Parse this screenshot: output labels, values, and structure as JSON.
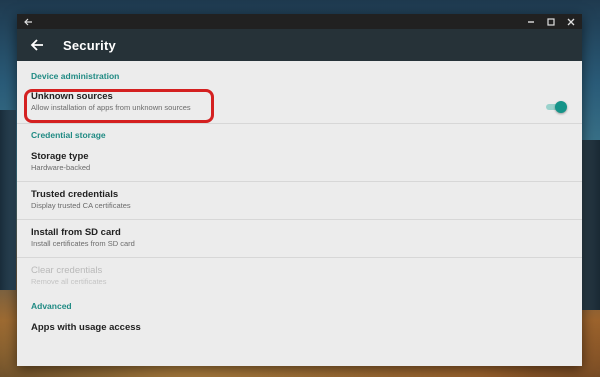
{
  "window": {
    "title_icons": [
      "back-arrow-icon",
      "minimize-icon",
      "maximize-icon",
      "close-icon"
    ]
  },
  "appbar": {
    "title": "Security"
  },
  "sections": {
    "device_admin": "Device administration",
    "credential_storage": "Credential storage",
    "advanced": "Advanced"
  },
  "prefs": {
    "unknown_sources": {
      "title": "Unknown sources",
      "summary": "Allow installation of apps from unknown sources",
      "enabled": true
    },
    "storage_type": {
      "title": "Storage type",
      "summary": "Hardware-backed"
    },
    "trusted_credentials": {
      "title": "Trusted credentials",
      "summary": "Display trusted CA certificates"
    },
    "install_sd": {
      "title": "Install from SD card",
      "summary": "Install certificates from SD card"
    },
    "clear_credentials": {
      "title": "Clear credentials",
      "summary": "Remove all certificates"
    },
    "usage_access": {
      "title": "Apps with usage access"
    }
  },
  "colors": {
    "accent": "#1f8a83",
    "appbar": "#263238",
    "highlight": "#d42020",
    "toggle_thumb": "#159489"
  }
}
